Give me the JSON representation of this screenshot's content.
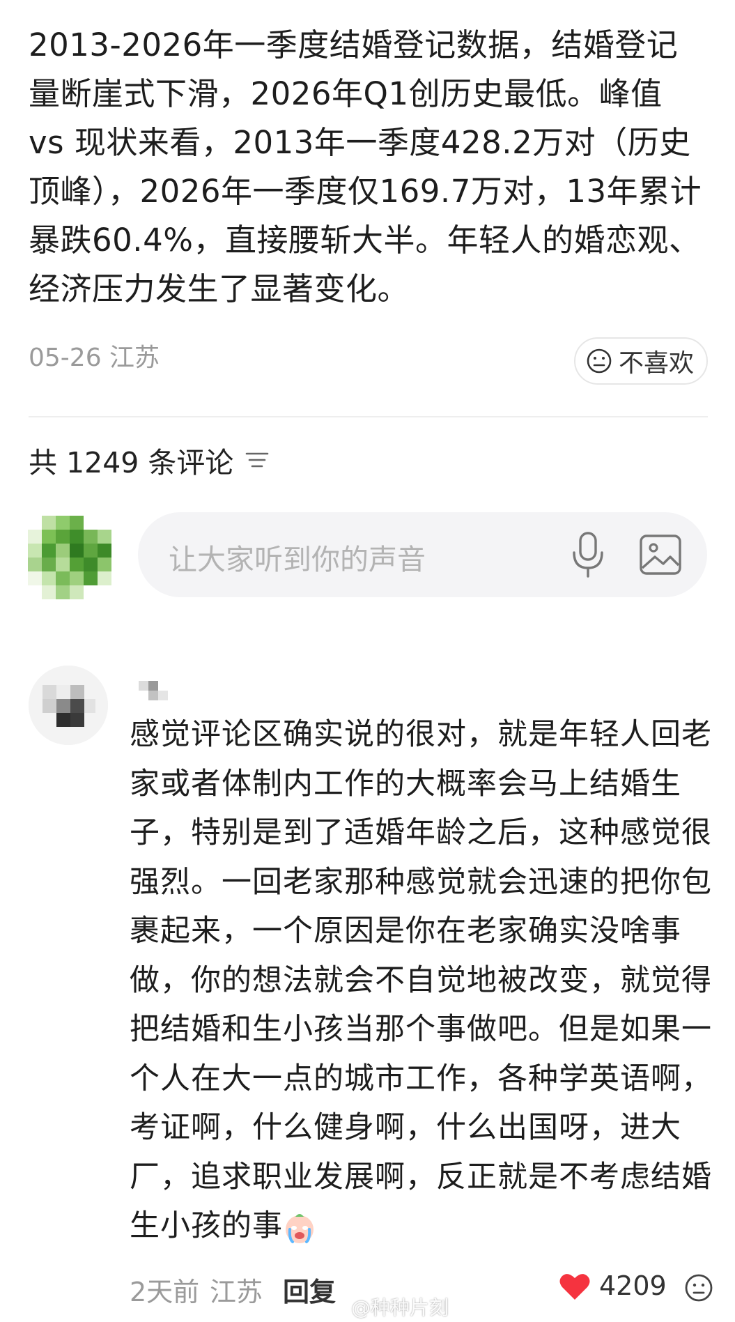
{
  "post": {
    "text": "2013-2026年一季度结婚登记数据，结婚登记量断崖式下滑，2026年Q1创历史最低。峰值 vs 现状来看，2013年一季度428.2万对（历史顶峰），2026年一季度仅169.7万对，13年累计暴跌60.4%，直接腰斩大半。年轻人的婚恋观、经济压力发生了显著变化。",
    "meta": "05-26 江苏",
    "dislike_label": "不喜欢"
  },
  "comments_header": {
    "count_label": "共 1249 条评论",
    "sort_icon": "sort-icon"
  },
  "composer": {
    "placeholder": "让大家听到你的声音",
    "mic_icon": "microphone-icon",
    "image_icon": "image-icon"
  },
  "comment": {
    "text": "感觉评论区确实说的很对，就是年轻人回老家或者体制内工作的大概率会马上结婚生子，特别是到了适婚年龄之后，这种感觉很强烈。一回老家那种感觉就会迅速的把你包裹起来，一个原因是你在老家确实没啥事做，你的想法就会不自觉地被改变，就觉得把结婚和生小孩当那个事做吧。但是如果一个人在大一点的城市工作，各种学英语啊，考证啊，什么健身啊，什么出国呀，进大厂，追求职业发展啊，反正就是不考虑结婚生小孩的事",
    "time": "2天前",
    "location": "江苏",
    "reply_label": "回复",
    "like_count": "4209"
  },
  "watermark": "@种种片刻",
  "colors": {
    "like_red": "#f5333f",
    "meta_gray": "#9a9a9a",
    "input_bg": "#f4f4f6"
  }
}
